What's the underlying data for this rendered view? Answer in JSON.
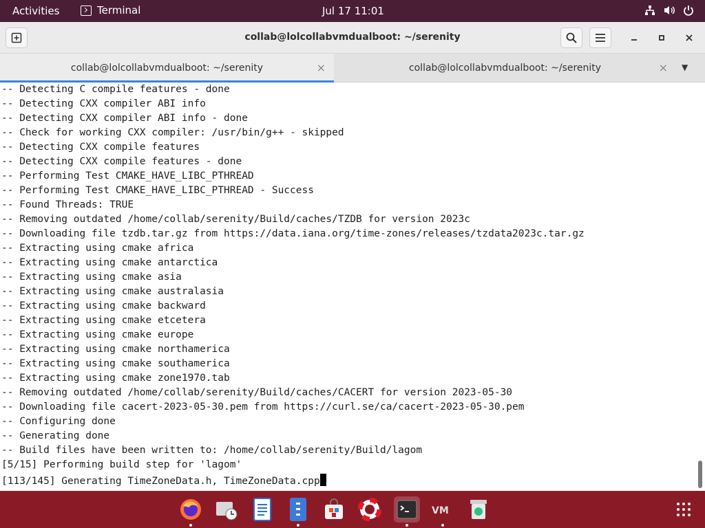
{
  "topbar": {
    "activities": "Activities",
    "app_name": "Terminal",
    "clock": "Jul 17  11:01",
    "tray_icons": [
      "network-icon",
      "volume-icon",
      "power-icon"
    ]
  },
  "window": {
    "title": "collab@lolcollabvmdualboot: ~/serenity",
    "tabs": [
      {
        "label": "collab@lolcollabvmdualboot: ~/serenity",
        "active": true
      },
      {
        "label": "collab@lolcollabvmdualboot: ~/serenity",
        "active": false
      }
    ]
  },
  "terminal": {
    "lines": [
      "-- Detecting C compile features - done",
      "-- Detecting CXX compiler ABI info",
      "-- Detecting CXX compiler ABI info - done",
      "-- Check for working CXX compiler: /usr/bin/g++ - skipped",
      "-- Detecting CXX compile features",
      "-- Detecting CXX compile features - done",
      "-- Performing Test CMAKE_HAVE_LIBC_PTHREAD",
      "-- Performing Test CMAKE_HAVE_LIBC_PTHREAD - Success",
      "-- Found Threads: TRUE",
      "-- Removing outdated /home/collab/serenity/Build/caches/TZDB for version 2023c",
      "-- Downloading file tzdb.tar.gz from https://data.iana.org/time-zones/releases/tzdata2023c.tar.gz",
      "-- Extracting using cmake africa",
      "-- Extracting using cmake antarctica",
      "-- Extracting using cmake asia",
      "-- Extracting using cmake australasia",
      "-- Extracting using cmake backward",
      "-- Extracting using cmake etcetera",
      "-- Extracting using cmake europe",
      "-- Extracting using cmake northamerica",
      "-- Extracting using cmake southamerica",
      "-- Extracting using cmake zone1970.tab",
      "-- Removing outdated /home/collab/serenity/Build/caches/CACERT for version 2023-05-30",
      "-- Downloading file cacert-2023-05-30.pem from https://curl.se/ca/cacert-2023-05-30.pem",
      "-- Configuring done",
      "-- Generating done",
      "-- Build files have been written to: /home/collab/serenity/Build/lagom",
      "[5/15] Performing build step for 'lagom'",
      "[113/145] Generating TimeZoneData.h, TimeZoneData.cpp"
    ]
  },
  "dock": {
    "apps": [
      {
        "name": "firefox",
        "running": true
      },
      {
        "name": "mail",
        "running": false
      },
      {
        "name": "writer",
        "running": false
      },
      {
        "name": "files",
        "running": true
      },
      {
        "name": "software",
        "running": false
      },
      {
        "name": "help",
        "running": false
      },
      {
        "name": "terminal",
        "running": true
      },
      {
        "name": "vm",
        "running": true
      },
      {
        "name": "trash",
        "running": false
      }
    ]
  }
}
